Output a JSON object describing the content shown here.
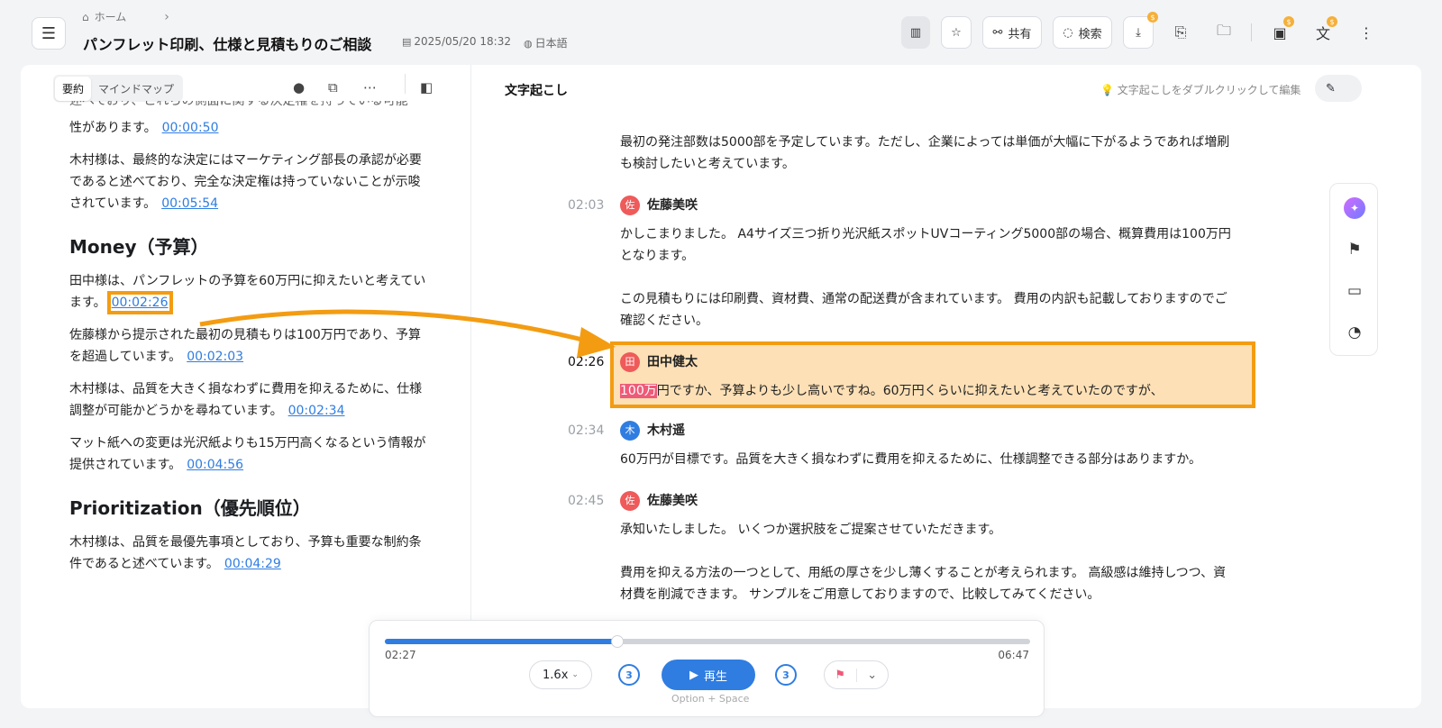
{
  "header": {
    "breadcrumb_home": "ホーム",
    "title": "パンフレット印刷、仕様と見積もりのご相談",
    "date": "2025/05/20 18:32",
    "language": "日本語",
    "share_label": "共有",
    "search_label": "検索"
  },
  "left": {
    "tab_summary": "要約",
    "tab_mindmap": "マインドマップ",
    "partial_top": "述べており、これらの側面に関する決定権を持っている可能",
    "items": [
      {
        "text": "性があります。",
        "ts": "00:00:50"
      },
      {
        "text": "木村様は、最終的な決定にはマーケティング部長の承認が必要であると述べており、完全な決定権は持っていないことが示唆されています。",
        "ts": "00:05:54"
      }
    ],
    "section_money": "Money（予算）",
    "money_items": [
      {
        "text": "田中様は、パンフレットの予算を60万円に抑えたいと考えています。",
        "ts": "00:02:26"
      },
      {
        "text": "佐藤様から提示された最初の見積もりは100万円であり、予算を超過しています。",
        "ts": "00:02:03"
      },
      {
        "text": "木村様は、品質を大きく損なわずに費用を抑えるために、仕様調整が可能かどうかを尋ねています。",
        "ts": "00:02:34"
      },
      {
        "text": "マット紙への変更は光沢紙よりも15万円高くなるという情報が提供されています。",
        "ts": "00:04:56"
      }
    ],
    "section_priority": "Prioritization（優先順位）",
    "priority_items": [
      {
        "text": "木村様は、品質を最優先事項としており、予算も重要な制約条件であると述べています。",
        "ts": "00:04:29"
      }
    ]
  },
  "right": {
    "title": "文字起こし",
    "hint": "文字起こしをダブルクリックして編集",
    "intro_line1": "最初の発注部数は5000部を予定しています。ただし、企業によっては単価が大幅に下がるようであれば増刷",
    "intro_line2": "も検討したいと考えています。",
    "segments": [
      {
        "time": "02:03",
        "avatar": "佐",
        "speaker": "佐藤美咲",
        "lines": [
          "かしこまりました。 A4サイズ三つ折り光沢紙スポットUVコーティング5000部の場合、概算費用は100万円",
          "となります。",
          "",
          "この見積もりには印刷費、資材費、通常の配送費が含まれています。 費用の内訳も記載しておりますのでご",
          "確認ください。"
        ]
      },
      {
        "time": "02:26",
        "avatar": "田",
        "speaker": "田中健太",
        "keyword": "100万",
        "rest": "円ですか、予算よりも少し高いですね。60万円くらいに抑えたいと考えていたのですが、"
      },
      {
        "time": "02:34",
        "avatar": "木",
        "speaker": "木村遥",
        "lines": [
          "60万円が目標です。品質を大きく損なわずに費用を抑えるために、仕様調整できる部分はありますか。"
        ]
      },
      {
        "time": "02:45",
        "avatar": "佐",
        "speaker": "佐藤美咲",
        "lines": [
          "承知いたしました。 いくつか選択肢をご提案させていただきます。",
          "",
          "費用を抑える方法の一つとして、用紙の厚さを少し薄くすることが考えられます。 高級感は維持しつつ、資",
          "材費を削減できます。 サンプルをご用意しておりますので、比較してみてください。"
        ]
      }
    ]
  },
  "player": {
    "current": "02:27",
    "total": "06:47",
    "progress": 0.361,
    "speed": "1.6x",
    "skip": "3",
    "play_label": "再生",
    "shortcut": "Option + Space"
  },
  "colors": {
    "accent": "#2f7de1",
    "highlight_border": "#f39c12",
    "highlight_fill": "#fde0b6"
  }
}
